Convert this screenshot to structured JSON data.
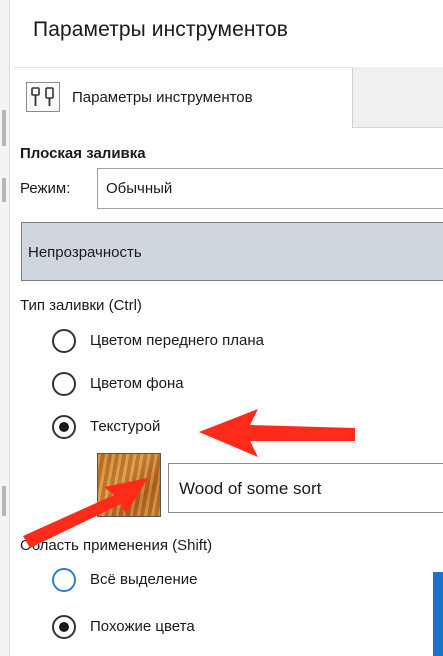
{
  "window": {
    "title": "Параметры инструментов"
  },
  "tab": {
    "label": "Параметры инструментов",
    "icon": "tool-options-icon"
  },
  "section": {
    "title": "Плоская заливка"
  },
  "mode": {
    "label": "Режим:",
    "value": "Обычный"
  },
  "opacity": {
    "label": "Непрозрачность"
  },
  "fill_type": {
    "label": "Тип заливки (Ctrl)",
    "options": [
      {
        "label": "Цветом переднего плана",
        "selected": false
      },
      {
        "label": "Цветом фона",
        "selected": false
      },
      {
        "label": "Текстурой",
        "selected": true
      }
    ]
  },
  "texture": {
    "name": "Wood of some sort",
    "swatch_icon": "wood-texture-swatch"
  },
  "affected_area": {
    "label": "Область применения (Shift)",
    "options": [
      {
        "label": "Всё выделение",
        "selected": false
      },
      {
        "label": "Похожие цвета",
        "selected": true
      }
    ]
  },
  "annotations": {
    "arrow_color": "#ff2a1a"
  },
  "colors": {
    "accent": "#2a7dd6",
    "opacity_bar": "#cfd6de",
    "highlight_edge": "#1f6fd1"
  }
}
